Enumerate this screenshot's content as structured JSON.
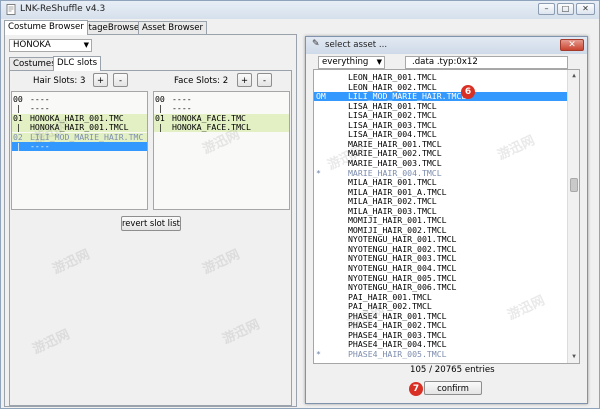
{
  "window": {
    "title": "LNK-ReShuffle v4.3",
    "minimize": "–",
    "maximize": "□",
    "close": "✕"
  },
  "tabs": [
    "Costume Browser",
    "StageBrowser",
    "Asset Browser"
  ],
  "character_select": "HONOKA",
  "subtabs": [
    "Costumes",
    "DLC slots"
  ],
  "hair": {
    "label": "Hair Slots: 3",
    "add": "+",
    "remove": "-",
    "rows": [
      {
        "idx": "00",
        "text": "----"
      },
      {
        "idx": "|",
        "text": "----"
      },
      {
        "idx": "01",
        "text": "HONOKA_HAIR_001.TMC"
      },
      {
        "idx": "|",
        "text": "HONOKA_HAIR_001.TMCL"
      },
      {
        "idx": "02",
        "text": "LILI_MOD_MARIE_HAIR.TMC"
      },
      {
        "idx": "|",
        "text": "----"
      }
    ]
  },
  "face": {
    "label": "Face Slots: 2",
    "add": "+",
    "remove": "-",
    "rows": [
      {
        "idx": "00",
        "text": "----"
      },
      {
        "idx": "|",
        "text": "----"
      },
      {
        "idx": "01",
        "text": "HONOKA_FACE.TMC"
      },
      {
        "idx": "|",
        "text": "HONOKA_FACE.TMCL"
      }
    ]
  },
  "revert_button": "revert slot list",
  "dialog": {
    "title": "select asset ...",
    "close": "✕",
    "filter": "everything",
    "type_filter": ".data .typ:0x12",
    "rows": [
      {
        "mark": "",
        "name": "LEON_HAIR_001.TMCL"
      },
      {
        "mark": "",
        "name": "LEON_HAIR_002.TMCL"
      },
      {
        "mark": "OM",
        "name": "LILI_MOD_MARIE_HAIR.TMCL"
      },
      {
        "mark": "",
        "name": "LISA_HAIR_001.TMCL"
      },
      {
        "mark": "",
        "name": "LISA_HAIR_002.TMCL"
      },
      {
        "mark": "",
        "name": "LISA_HAIR_003.TMCL"
      },
      {
        "mark": "",
        "name": "LISA_HAIR_004.TMCL"
      },
      {
        "mark": "",
        "name": "MARIE_HAIR_001.TMCL"
      },
      {
        "mark": "",
        "name": "MARIE_HAIR_002.TMCL"
      },
      {
        "mark": "",
        "name": "MARIE_HAIR_003.TMCL"
      },
      {
        "mark": "*",
        "name": "MARIE_HAIR_004.TMCL"
      },
      {
        "mark": "",
        "name": "MILA_HAIR_001.TMCL"
      },
      {
        "mark": "",
        "name": "MILA_HAIR_001_A.TMCL"
      },
      {
        "mark": "",
        "name": "MILA_HAIR_002.TMCL"
      },
      {
        "mark": "",
        "name": "MILA_HAIR_003.TMCL"
      },
      {
        "mark": "",
        "name": "MOMIJI_HAIR_001.TMCL"
      },
      {
        "mark": "",
        "name": "MOMIJI_HAIR_002.TMCL"
      },
      {
        "mark": "",
        "name": "NYOTENGU_HAIR_001.TMCL"
      },
      {
        "mark": "",
        "name": "NYOTENGU_HAIR_002.TMCL"
      },
      {
        "mark": "",
        "name": "NYOTENGU_HAIR_003.TMCL"
      },
      {
        "mark": "",
        "name": "NYOTENGU_HAIR_004.TMCL"
      },
      {
        "mark": "",
        "name": "NYOTENGU_HAIR_005.TMCL"
      },
      {
        "mark": "",
        "name": "NYOTENGU_HAIR_006.TMCL"
      },
      {
        "mark": "",
        "name": "PAI_HAIR_001.TMCL"
      },
      {
        "mark": "",
        "name": "PAI_HAIR_002.TMCL"
      },
      {
        "mark": "",
        "name": "PHASE4_HAIR_001.TMCL"
      },
      {
        "mark": "",
        "name": "PHASE4_HAIR_002.TMCL"
      },
      {
        "mark": "",
        "name": "PHASE4_HAIR_003.TMCL"
      },
      {
        "mark": "",
        "name": "PHASE4_HAIR_004.TMCL"
      },
      {
        "mark": "*",
        "name": "PHASE4_HAIR_005.TMCL"
      }
    ],
    "selected_index": 2,
    "count": "105 / 20765 entries",
    "confirm": "confirm"
  },
  "badges": [
    "6",
    "7"
  ],
  "watermark": "游迅网",
  "colors": {
    "selection": "#3399ff",
    "highlight": "#e3f0c4",
    "badge": "#d93025"
  }
}
